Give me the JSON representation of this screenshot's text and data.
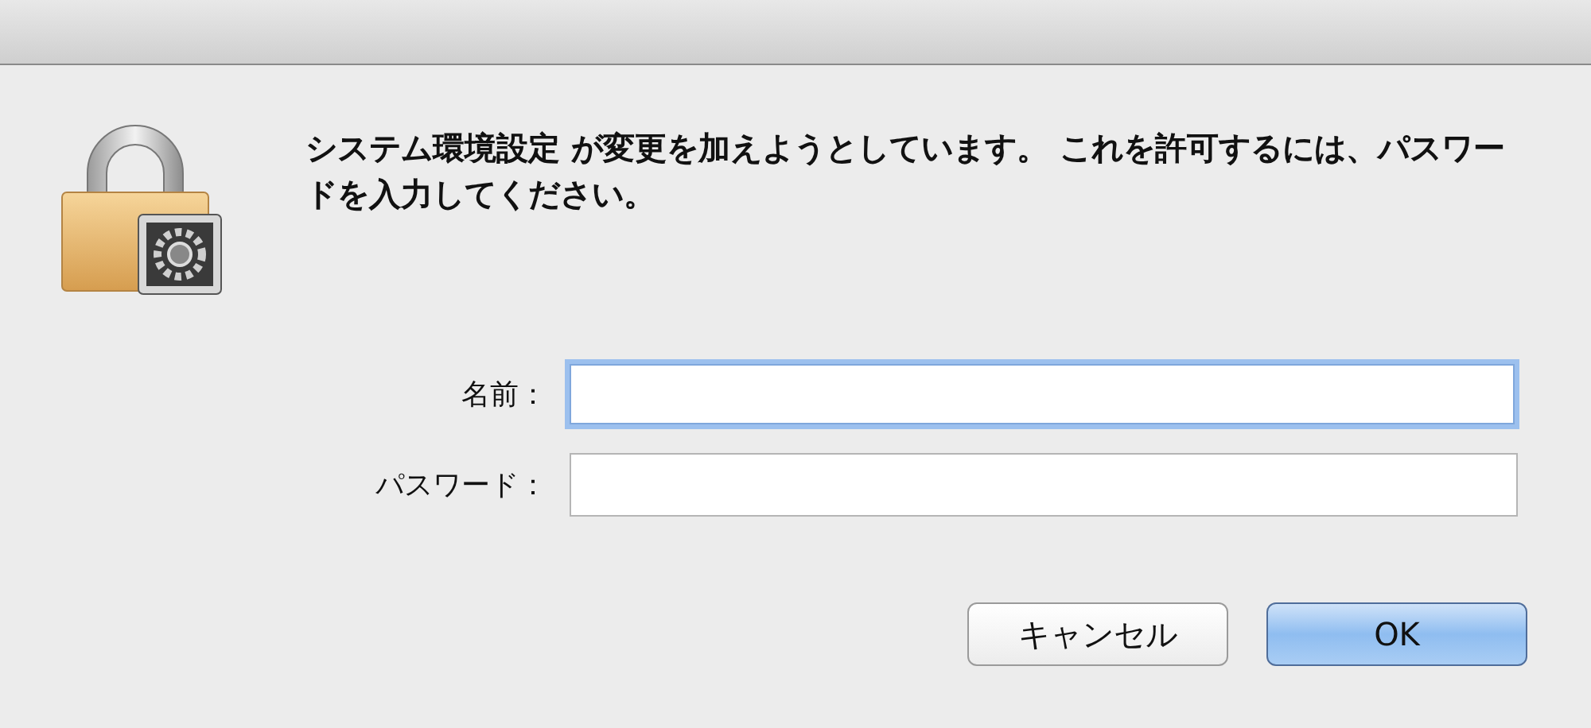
{
  "message": "システム環境設定 が変更を加えようとしています。 これを許可するには、パスワードを入力してください。",
  "fields": [
    {
      "label": "名前：",
      "focused": true
    },
    {
      "label": "パスワード：",
      "focused": false
    }
  ],
  "buttons": [
    {
      "label": "キャンセル",
      "kind": "normal"
    },
    {
      "label": "OK",
      "kind": "default"
    }
  ]
}
